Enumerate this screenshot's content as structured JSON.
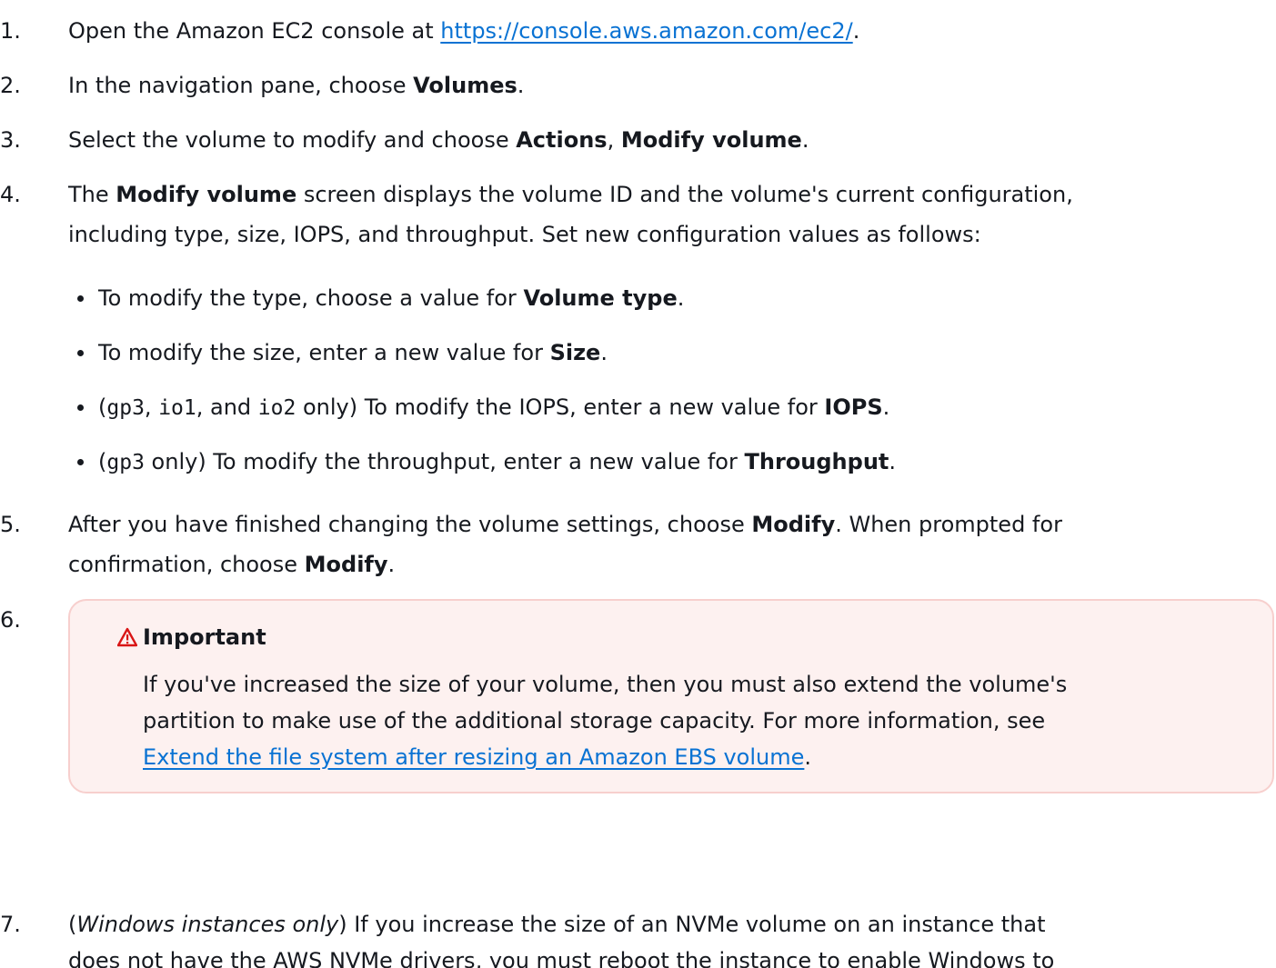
{
  "steps": [
    {
      "num": "1.",
      "before": "Open the Amazon EC2 console at ",
      "link": "https://console.aws.amazon.com/ec2/",
      "after": "."
    },
    {
      "num": "2.",
      "before": "In the navigation pane, choose ",
      "bold": "Volumes",
      "after": "."
    },
    {
      "num": "3.",
      "before": "Select the volume to modify and choose ",
      "bold1": "Actions",
      "mid": ", ",
      "bold2": "Modify volume",
      "after": "."
    },
    {
      "num": "4.",
      "before": "The ",
      "bold": "Modify volume",
      "line1_after": " screen displays the volume ID and the volume's current configuration,",
      "line2": "including type, size, IOPS, and throughput. Set new configuration values as follows:",
      "bullets": [
        {
          "before": "To modify the type, choose a value for ",
          "bold": "Volume type",
          "after": "."
        },
        {
          "before": "To modify the size, enter a new value for ",
          "bold": "Size",
          "after": "."
        },
        {
          "open": "(",
          "code1": "gp3",
          "sep1": ", ",
          "code2": "io1",
          "sep2": ", and ",
          "code3": "io2",
          "before": " only) To modify the IOPS, enter a new value for ",
          "bold": "IOPS",
          "after": "."
        },
        {
          "open": "(",
          "code1": "gp3",
          "before": " only) To modify the throughput, enter a new value for ",
          "bold": "Throughput",
          "after": "."
        }
      ]
    },
    {
      "num": "5.",
      "line1_before": "After you have finished changing the volume settings, choose ",
      "bold1": "Modify",
      "line1_after": ". When prompted for",
      "line2_before": "confirmation, choose ",
      "bold2": "Modify",
      "after": "."
    },
    {
      "num": "6.",
      "alert": {
        "title": "Important",
        "line1": "If you've increased the size of your volume, then you must also extend the volume's",
        "line2": "partition to make use of the additional storage capacity. For more information, see",
        "link": "Extend the file system after resizing an Amazon EBS volume",
        "after": "."
      }
    },
    {
      "num": "7.",
      "open": "(",
      "italic": "Windows instances only",
      "line1_after": ") If you increase the size of an NVMe volume on an instance that",
      "line2": "does not have the AWS NVMe drivers, you must reboot the instance to enable Windows to"
    }
  ],
  "colors": {
    "link": "#0972d3",
    "alert_bg": "#fdf1f0",
    "alert_border": "#f7cfcd",
    "warning_icon": "#d91515"
  },
  "icons": {
    "alert": "warning-triangle-icon"
  }
}
